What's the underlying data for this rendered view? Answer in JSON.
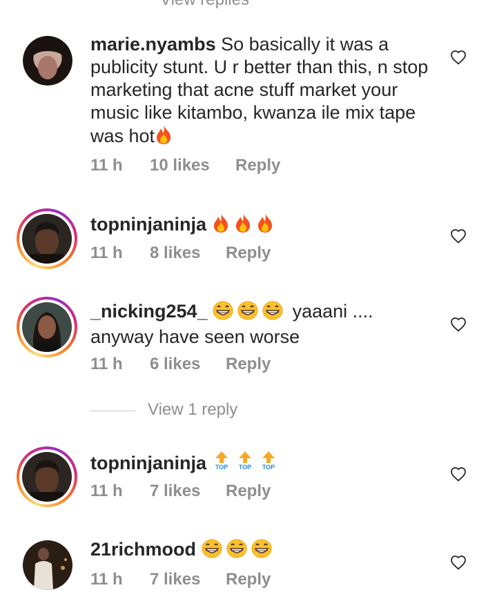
{
  "top_partial_text": "View replies",
  "comments": [
    {
      "username": "marie.nyambs",
      "text": " So basically it was a publicity stunt. U r better than this, n stop marketing that acne stuff market your music like kitambo, kwanza ile mix tape was hot",
      "emoji": [
        "fire"
      ],
      "time": "11 h",
      "likes": "10 likes",
      "reply": "Reply",
      "avatar_ring": false
    },
    {
      "username": "topninjaninja",
      "text": " ",
      "emoji": [
        "fire",
        "fire",
        "fire"
      ],
      "time": "11 h",
      "likes": "8 likes",
      "reply": "Reply",
      "avatar_ring": true
    },
    {
      "username": "_nicking254_",
      "text": " yaaani .... anyway have seen worse",
      "emoji": [
        "grin",
        "grin",
        "grin"
      ],
      "time": "11 h",
      "likes": "6 likes",
      "reply": "Reply",
      "avatar_ring": true
    },
    {
      "username": "topninjaninja",
      "text": " ",
      "emoji": [
        "top-arrow",
        "top-arrow",
        "top-arrow"
      ],
      "emoji_caption": "TOP",
      "time": "11 h",
      "likes": "7 likes",
      "reply": "Reply",
      "avatar_ring": true
    },
    {
      "username": "21richmood",
      "text": " ",
      "emoji": [
        "grin",
        "grin",
        "grin"
      ],
      "time": "11 h",
      "likes": "7 likes",
      "reply": "Reply",
      "avatar_ring": false
    }
  ],
  "view_replies": "View 1 reply",
  "icons": {
    "heart": "heart-outline-icon",
    "fire": "fire-emoji",
    "grin": "grinning-emoji",
    "top": "top-arrow-emoji"
  },
  "colors": {
    "text": "#262626",
    "meta": "#8e8e8e",
    "fire_outer": "#f4511e",
    "fire_inner": "#ffc107",
    "grin_face": "#fbc02d",
    "top_arrow": "#f9a825",
    "top_text": "#1e88e5"
  }
}
